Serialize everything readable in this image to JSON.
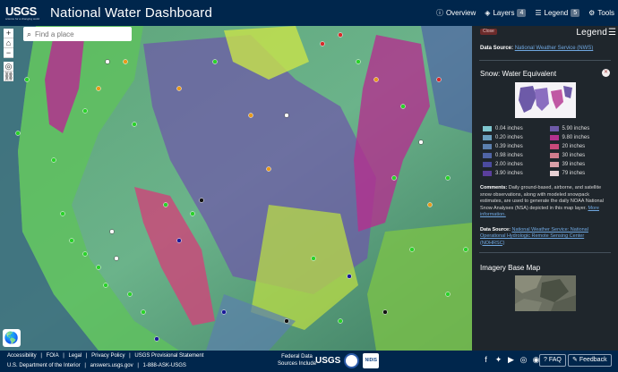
{
  "header": {
    "logo": "USGS",
    "logo_tagline": "science for a changing world",
    "title": "National Water Dashboard",
    "nav": [
      {
        "label": "Overview",
        "icon": "info-circle-icon"
      },
      {
        "label": "Layers",
        "icon": "layers-icon",
        "badge": "4"
      },
      {
        "label": "Legend",
        "icon": "list-icon",
        "badge": "5"
      },
      {
        "label": "Tools",
        "icon": "gear-icon"
      }
    ]
  },
  "map": {
    "controls": [
      "+",
      "⌂",
      "−"
    ],
    "search_placeholder": "Find a place"
  },
  "legend": {
    "close_label": "Close",
    "title": "Legend",
    "top_data_source": {
      "label": "Data Source:",
      "link": "National Weather Service (NWS)"
    },
    "snow": {
      "title": "Snow: Water Equivalent",
      "swatches": [
        {
          "label": "0.04 inches",
          "color": "#7fc6cf"
        },
        {
          "label": "5.90 inches",
          "color": "#6d5aa8"
        },
        {
          "label": "0.20 inches",
          "color": "#6a9fbf"
        },
        {
          "label": "9.80 inches",
          "color": "#b3318e"
        },
        {
          "label": "0.39 inches",
          "color": "#5b7fae"
        },
        {
          "label": "20 inches",
          "color": "#c94a7a"
        },
        {
          "label": "0.98 inches",
          "color": "#4f64a6"
        },
        {
          "label": "30 inches",
          "color": "#d07c8c"
        },
        {
          "label": "2.00 inches",
          "color": "#4b4ba0"
        },
        {
          "label": "39 inches",
          "color": "#d9a0a8"
        },
        {
          "label": "3.90 inches",
          "color": "#5a3f9c"
        },
        {
          "label": "79 inches",
          "color": "#e7d0d4"
        }
      ],
      "comments_label": "Comments:",
      "comments_text": "Daily ground-based, airborne, and satellite snow observations, along with modeled snowpack estimates, are used to generate the daily NOAA National Snow Analyses (NSA) depicted in this map layer.",
      "more_info": "More information.",
      "data_source_label": "Data Source:",
      "data_source_link": "National Weather Service: National Operational Hydrologic Remote Sensing Center (NOHRSC)"
    },
    "imagery": {
      "title": "Imagery Base Map"
    }
  },
  "footer": {
    "links_row1": [
      "Accessibility",
      "|",
      "FOIA",
      "|",
      "Legal",
      "|",
      "Privacy Policy",
      "|",
      "USGS Provisional Statement"
    ],
    "links_row2": [
      "U.S. Department of the Interior",
      "|",
      "answers.usgs.gov",
      "|",
      "1-888-ASK-USGS"
    ],
    "federal_line1": "Federal Data",
    "federal_line2": "Sources Include",
    "federal_logos": [
      "USGS",
      "NWS",
      "NIDIS"
    ],
    "social": [
      "facebook-icon",
      "twitter-icon",
      "youtube-icon",
      "instagram-icon",
      "rss-icon"
    ],
    "faq": "FAQ",
    "feedback": "Feedback"
  },
  "colors": {
    "header_bg": "#00264c",
    "panel_bg": "#1f262c",
    "link": "#6fa7e0"
  }
}
